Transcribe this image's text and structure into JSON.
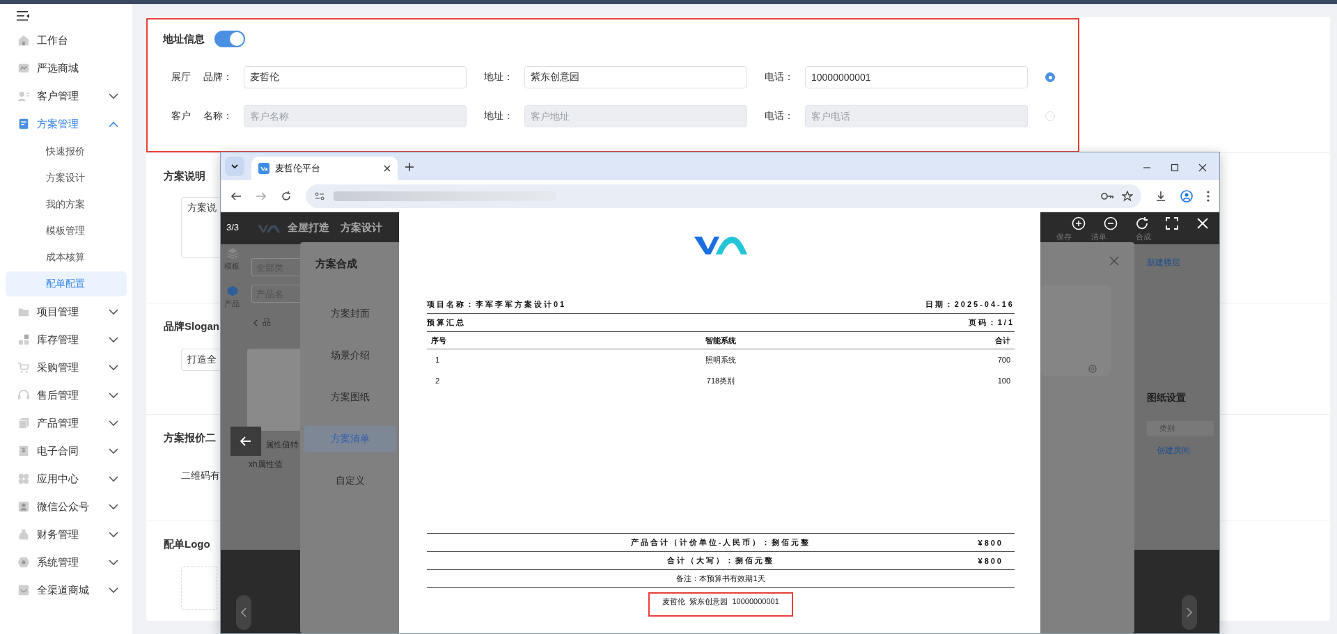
{
  "sidebar": {
    "items": [
      {
        "kind": "link",
        "label": "工作台",
        "selected": false
      },
      {
        "kind": "link",
        "label": "严选商城",
        "selected": false
      },
      {
        "kind": "group",
        "label": "客户管理",
        "selected": false,
        "expanded": false
      },
      {
        "kind": "group",
        "label": "方案管理",
        "selected": true,
        "expanded": true,
        "children": [
          {
            "label": "快速报价",
            "selected": false
          },
          {
            "label": "方案设计",
            "selected": false
          },
          {
            "label": "我的方案",
            "selected": false
          },
          {
            "label": "模板管理",
            "selected": false
          },
          {
            "label": "成本核算",
            "selected": false
          },
          {
            "label": "配单配置",
            "selected": true
          }
        ]
      },
      {
        "kind": "group",
        "label": "项目管理",
        "selected": false,
        "expanded": false
      },
      {
        "kind": "group",
        "label": "库存管理",
        "selected": false,
        "expanded": false
      },
      {
        "kind": "group",
        "label": "采购管理",
        "selected": false,
        "expanded": false
      },
      {
        "kind": "group",
        "label": "售后管理",
        "selected": false,
        "expanded": false
      },
      {
        "kind": "group",
        "label": "产品管理",
        "selected": false,
        "expanded": false
      },
      {
        "kind": "group",
        "label": "电子合同",
        "selected": false,
        "expanded": false
      },
      {
        "kind": "group",
        "label": "应用中心",
        "selected": false,
        "expanded": false
      },
      {
        "kind": "group",
        "label": "微信公众号",
        "selected": false,
        "expanded": false
      },
      {
        "kind": "group",
        "label": "财务管理",
        "selected": false,
        "expanded": false
      },
      {
        "kind": "group",
        "label": "系统管理",
        "selected": false,
        "expanded": false
      },
      {
        "kind": "group",
        "label": "全渠道商城",
        "selected": false,
        "expanded": false
      }
    ]
  },
  "address": {
    "title": "地址信息",
    "enabled": true,
    "highlighted": true,
    "rows": [
      {
        "label": "展厅",
        "selected": true,
        "fields": [
          {
            "label": "品牌：",
            "value": "麦哲伦",
            "disabled": false
          },
          {
            "label": "地址：",
            "value": "紫东创意园",
            "disabled": false
          },
          {
            "label": "电话：",
            "value": "10000000001",
            "disabled": false
          }
        ]
      },
      {
        "label": "客户",
        "selected": false,
        "fields": [
          {
            "label": "名称：",
            "placeholder": "客户名称",
            "disabled": true
          },
          {
            "label": "地址：",
            "placeholder": "客户地址",
            "disabled": true
          },
          {
            "label": "电话：",
            "placeholder": "客户电话",
            "disabled": true
          }
        ]
      }
    ]
  },
  "sections": [
    {
      "kind": "textarea",
      "title": "方案说明",
      "value": "方案说"
    },
    {
      "kind": "input",
      "title": "品牌Slogan",
      "value": "打造全"
    },
    {
      "kind": "text",
      "title": "方案报价二",
      "text": "二维码有"
    },
    {
      "kind": "upload",
      "title": "配单Logo"
    }
  ],
  "browser": {
    "tab": {
      "title": "麦哲伦平台"
    },
    "viewer": {
      "counter": "3/3"
    },
    "app": {
      "brand": "全屋打造",
      "module": "方案设计",
      "toolbar": [
        "保存",
        "清单",
        "合成"
      ],
      "side_tools": [
        "模板",
        "产品"
      ],
      "filters": [
        "全部类",
        "产品名"
      ],
      "category": "品",
      "products": [
        "属性值特",
        "xh属性值"
      ],
      "right_panel": {
        "action": "新建楼层",
        "heading": "图纸设置",
        "column": "类别",
        "link": "创建房间"
      }
    },
    "dialog": {
      "title": "方案合成",
      "tabs": [
        {
          "label": "方案封面",
          "selected": false
        },
        {
          "label": "场景介绍",
          "selected": false
        },
        {
          "label": "方案图纸",
          "selected": false
        },
        {
          "label": "方案清单",
          "selected": true
        },
        {
          "label": "自定义",
          "selected": false
        }
      ]
    },
    "document": {
      "project": "项目名称：李军李军方案设计01",
      "date": "日期：2025-04-16",
      "section": "预算汇总",
      "page": "页码：1/1",
      "columns": [
        "序号",
        "智能系统",
        "合计"
      ],
      "rows": [
        [
          "1",
          "照明系统",
          "700"
        ],
        [
          "2",
          "718类别",
          "100"
        ]
      ],
      "totals": [
        {
          "label": "产品合计（计价单位-人民币）：捌佰元整",
          "amount": "¥800"
        },
        {
          "label": "合计（大写）：捌佰元整",
          "amount": "¥800"
        }
      ],
      "note": "备注：本预算书有效期1天",
      "footer": {
        "text": "麦哲伦  紫东创意园  10000000001",
        "highlighted": true
      }
    }
  }
}
